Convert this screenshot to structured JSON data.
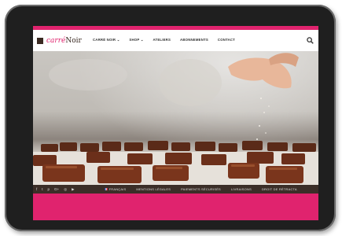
{
  "colors": {
    "accent": "#e0236e",
    "footer": "#3b2e28"
  },
  "logo": {
    "part1": "carré",
    "part2": "Noir"
  },
  "nav": {
    "items": [
      {
        "label": "CARRÉ NOIR ⌄"
      },
      {
        "label": "SHOP ⌄"
      },
      {
        "label": "ATELIERS"
      },
      {
        "label": "ABONNEMENTS"
      },
      {
        "label": "CONTACT"
      }
    ],
    "search_icon": "search-icon"
  },
  "footer": {
    "social": [
      "f",
      "t",
      "p",
      "G+",
      "◎",
      "▶"
    ],
    "language": "FRANÇAIS",
    "links": [
      "MENTIONS LÉGALES",
      "PAIEMENTS SÉCURISÉS",
      "LIVRAISONS",
      "DROIT DE RÉTRACTA"
    ]
  }
}
